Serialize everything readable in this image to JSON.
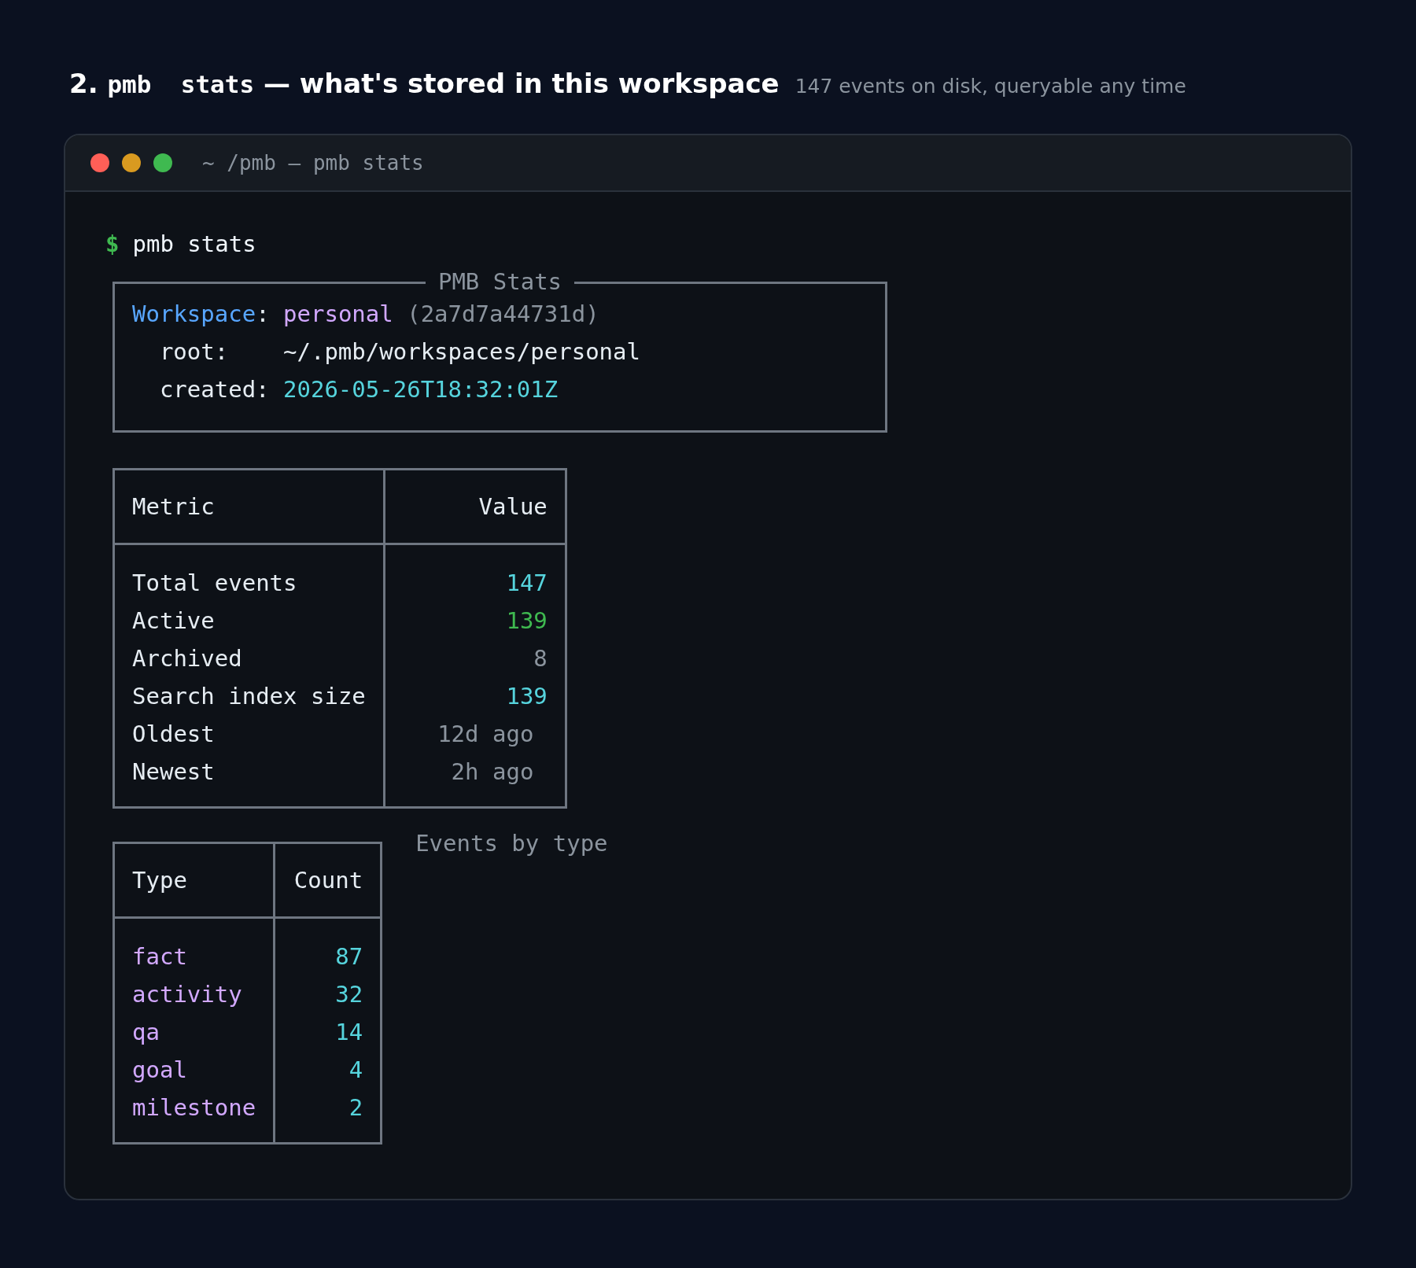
{
  "heading": {
    "number": "2.",
    "command": "pmb  stats",
    "rest": "— what's stored in this workspace",
    "subtitle": "147 events on disk, queryable any time"
  },
  "window": {
    "title": "~ /pmb — pmb stats"
  },
  "terminal": {
    "prompt": "$",
    "command": "pmb stats",
    "panel": {
      "title": "PMB Stats",
      "lines": [
        {
          "kind": "workspace",
          "label": "Workspace",
          "label_suffix": ":",
          "value": "personal",
          "id_text": "(2a7d7a44731d)"
        },
        {
          "kind": "field",
          "label": "root:",
          "value": "~/.pmb/workspaces/personal",
          "color": "#e6edf3"
        },
        {
          "kind": "field",
          "label": "created:",
          "value": "2026-05-26T18:32:01Z",
          "color": "#56d4dd"
        }
      ]
    }
  },
  "metrics": {
    "columns": [
      "Metric",
      "Value"
    ],
    "rows": [
      {
        "metric": "Total events",
        "value": "147",
        "color": "#56d4dd",
        "kind": "count"
      },
      {
        "metric": "Active",
        "value": "139",
        "color": "#3fb950",
        "kind": "count"
      },
      {
        "metric": "Archived",
        "value": "8",
        "color": "#8b949e",
        "kind": "count"
      },
      {
        "metric": "Search index size",
        "value": "139",
        "color": "#56d4dd",
        "kind": "count"
      },
      {
        "metric": "Oldest",
        "value": "12d ago",
        "color": "#8b949e",
        "kind": "age"
      },
      {
        "metric": "Newest",
        "value": "2h ago",
        "color": "#8b949e",
        "kind": "age"
      }
    ]
  },
  "types": {
    "caption": "Events by type",
    "columns": [
      "Type",
      "Count"
    ],
    "rows": [
      {
        "type": "fact",
        "count": "87"
      },
      {
        "type": "activity",
        "count": "32"
      },
      {
        "type": "qa",
        "count": "14"
      },
      {
        "type": "goal",
        "count": "4"
      },
      {
        "type": "milestone",
        "count": "2"
      }
    ]
  }
}
